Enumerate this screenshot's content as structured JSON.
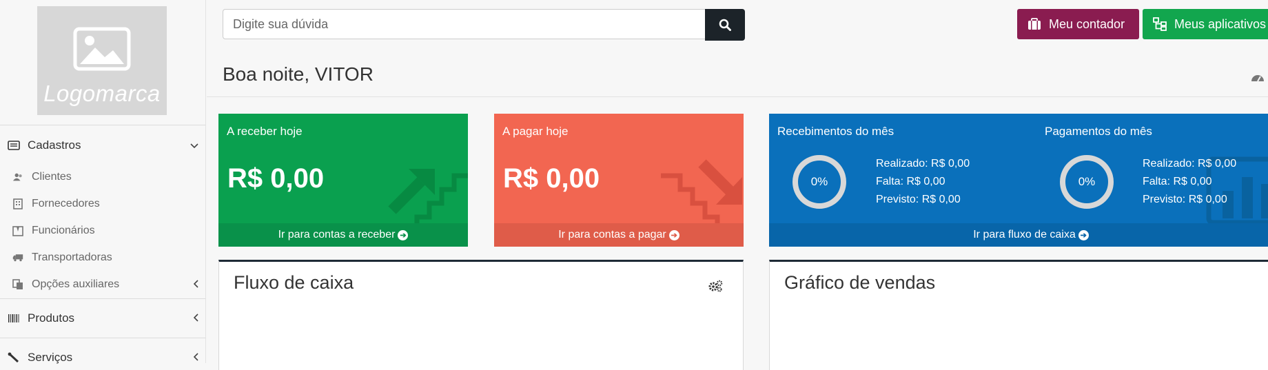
{
  "sidebar": {
    "logo_text": "Logomarca",
    "sections": [
      {
        "label": "Cadastros",
        "icon": "id-card-icon",
        "expanded": true
      },
      {
        "label": "Produtos",
        "icon": "barcode-icon",
        "expanded": false
      },
      {
        "label": "Serviços",
        "icon": "wrench-icon",
        "expanded": false
      }
    ],
    "items": [
      {
        "label": "Clientes",
        "icon": "users-icon"
      },
      {
        "label": "Fornecedores",
        "icon": "building-icon"
      },
      {
        "label": "Funcionários",
        "icon": "suit-icon"
      },
      {
        "label": "Transportadoras",
        "icon": "truck-icon"
      },
      {
        "label": "Opções auxiliares",
        "icon": "files-icon"
      }
    ]
  },
  "header": {
    "search_placeholder": "Digite sua dúvida",
    "contador_label": "Meu contador",
    "apps_label": "Meus aplicativos",
    "greeting": "Boa noite, VITOR"
  },
  "cards": {
    "receber": {
      "title": "A receber hoje",
      "value": "R$ 0,00",
      "link": "Ir para contas a receber"
    },
    "pagar": {
      "title": "A pagar hoje",
      "value": "R$ 0,00",
      "link": "Ir para contas a pagar"
    },
    "fluxo": {
      "recebimentos_title": "Recebimentos do mês",
      "recebimentos_percent": "0%",
      "recebimentos_realizado": "Realizado: R$ 0,00",
      "recebimentos_falta": "Falta: R$ 0,00",
      "recebimentos_previsto": "Previsto: R$ 0,00",
      "pagamentos_title": "Pagamentos do mês",
      "pagamentos_percent": "0%",
      "pagamentos_realizado": "Realizado: R$ 0,00",
      "pagamentos_falta": "Falta: R$ 0,00",
      "pagamentos_previsto": "Previsto: R$ 0,00",
      "link": "Ir para fluxo de caixa"
    }
  },
  "panels": {
    "fluxo_title": "Fluxo de caixa",
    "vendas_title": "Gráfico de vendas"
  },
  "colors": {
    "green": "#0aa04f",
    "red": "#f26651",
    "blue": "#0a70bb",
    "contador": "#8a1c50",
    "apps": "#12a64e",
    "dark": "#1c2329"
  }
}
